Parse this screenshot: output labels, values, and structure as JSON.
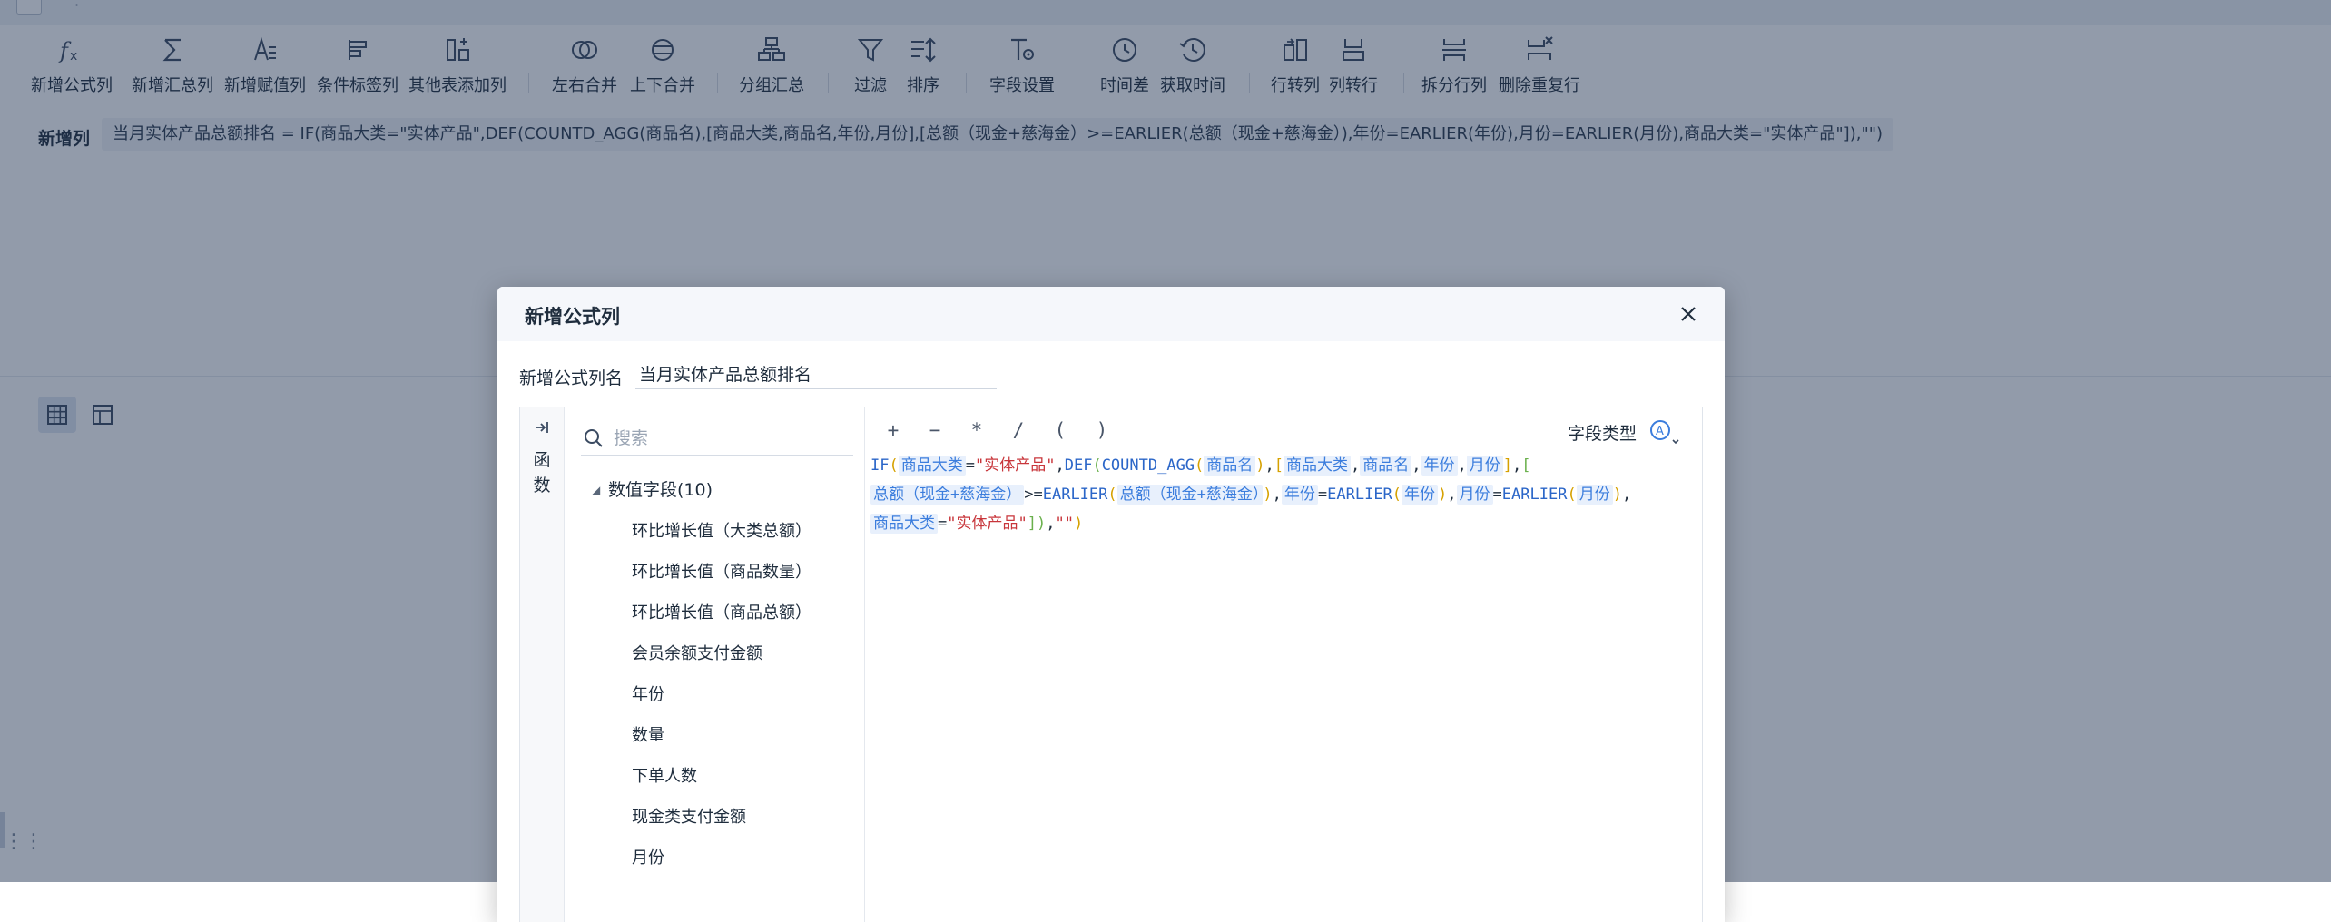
{
  "toolbar": {
    "items": [
      {
        "label": "新增公式列",
        "icon": "fx-icon"
      },
      {
        "label": "新增汇总列",
        "icon": "sigma-icon"
      },
      {
        "label": "新增赋值列",
        "icon": "assign-icon"
      },
      {
        "label": "条件标签列",
        "icon": "condition-tag-icon"
      },
      {
        "label": "其他表添加列",
        "icon": "add-column-icon"
      },
      {
        "label": "左右合并",
        "icon": "merge-lr-icon"
      },
      {
        "label": "上下合并",
        "icon": "merge-ud-icon"
      },
      {
        "label": "分组汇总",
        "icon": "group-icon"
      },
      {
        "label": "过滤",
        "icon": "filter-icon"
      },
      {
        "label": "排序",
        "icon": "sort-icon"
      },
      {
        "label": "字段设置",
        "icon": "field-settings-icon"
      },
      {
        "label": "时间差",
        "icon": "time-diff-icon"
      },
      {
        "label": "获取时间",
        "icon": "get-time-icon"
      },
      {
        "label": "行转列",
        "icon": "row-to-col-icon"
      },
      {
        "label": "列转行",
        "icon": "col-to-row-icon"
      },
      {
        "label": "拆分行列",
        "icon": "split-icon"
      },
      {
        "label": "删除重复行",
        "icon": "dedupe-icon"
      }
    ]
  },
  "formula_bar": {
    "label": "新增列",
    "text": "当月实体产品总额排名 = IF(商品大类=\"实体产品\",DEF(COUNTD_AGG(商品名),[商品大类,商品名,年份,月份],[总额（现金+慈海金）>=EARLIER(总额（现金+慈海金）),年份=EARLIER(年份),月份=EARLIER(月份),商品大类=\"实体产品\"]),\"\")"
  },
  "dialog": {
    "title": "新增公式列",
    "name_label": "新增公式列名",
    "name_value": "当月实体产品总额排名",
    "function_tab": "函数",
    "search_placeholder": "搜索",
    "tree_group": "数值字段(10)",
    "fields": [
      "环比增长值（大类总额）",
      "环比增长值（商品数量）",
      "环比增长值（商品总额）",
      "会员余额支付金额",
      "年份",
      "数量",
      "下单人数",
      "现金类支付金额",
      "月份"
    ],
    "operators": [
      "+",
      "−",
      "*",
      "/",
      "(",
      ")"
    ],
    "field_type_label": "字段类型"
  },
  "colors": {
    "accent": "#3b7ddd",
    "string": "#c8363b",
    "mask": "rgba(28,45,78,0.48)"
  }
}
